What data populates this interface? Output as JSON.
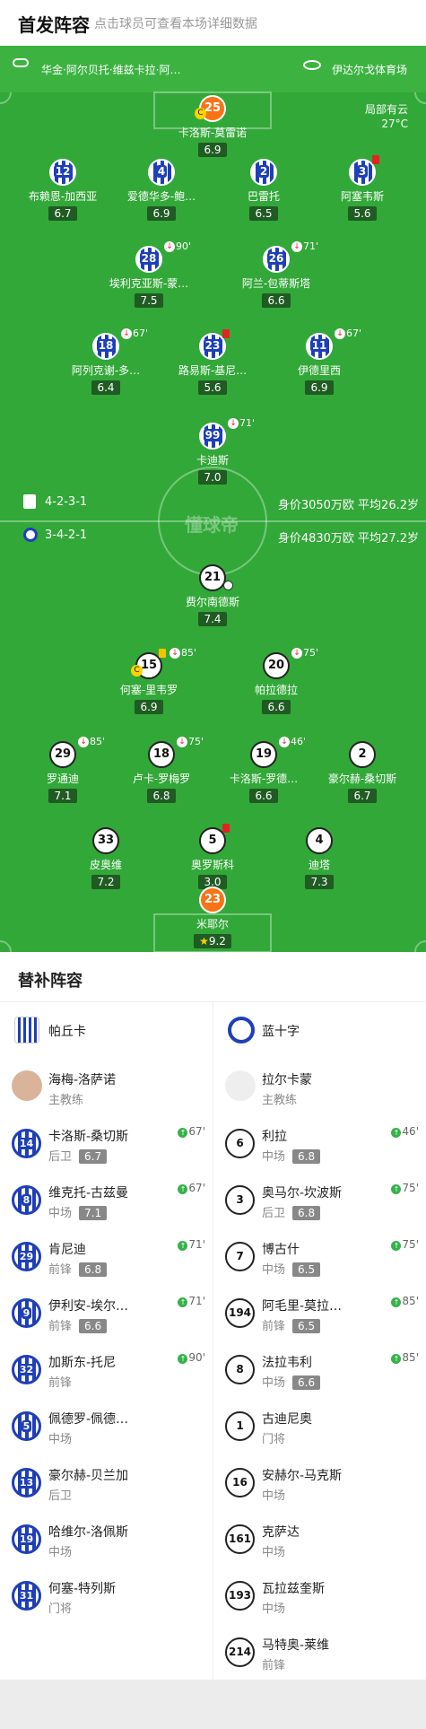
{
  "header": {
    "title": "首发阵容",
    "hint": "点击球员可查看本场详细数据"
  },
  "pitch": {
    "home_stadium": "华金·阿尔贝托·维兹卡拉·阿…",
    "away_stadium": "伊达尔戈体育场",
    "weather": "局部有云",
    "temperature": "27°C",
    "home_formation": "4-2-3-1",
    "home_value": "身价3050万欧 平均26.2岁",
    "away_formation": "3-4-2-1",
    "away_value": "身价4830万欧 平均27.2岁",
    "watermark": "懂球帝"
  },
  "home_players": [
    {
      "num": "25",
      "name": "卡洛斯-莫雷诺",
      "rating": "6.9"
    },
    {
      "num": "12",
      "name": "布赖恩-加西亚",
      "rating": "6.7"
    },
    {
      "num": "4",
      "name": "爱德华多-鲍…",
      "rating": "6.9"
    },
    {
      "num": "2",
      "name": "巴雷托",
      "rating": "6.5"
    },
    {
      "num": "3",
      "name": "阿塞韦斯",
      "rating": "5.6"
    },
    {
      "num": "28",
      "name": "埃利克亚斯-蒙…",
      "rating": "7.5",
      "sub": "90'"
    },
    {
      "num": "26",
      "name": "阿兰-包蒂斯塔",
      "rating": "6.6",
      "sub": "71'"
    },
    {
      "num": "18",
      "name": "阿列克谢-多…",
      "rating": "6.4",
      "sub": "67'"
    },
    {
      "num": "23",
      "name": "路易斯-基尼…",
      "rating": "5.6"
    },
    {
      "num": "11",
      "name": "伊德里西",
      "rating": "6.9",
      "sub": "67'"
    },
    {
      "num": "99",
      "name": "卡迪斯",
      "rating": "7.0",
      "sub": "71'"
    }
  ],
  "away_players": [
    {
      "num": "21",
      "name": "费尔南德斯",
      "rating": "7.4"
    },
    {
      "num": "15",
      "name": "何塞-里韦罗",
      "rating": "6.9",
      "sub": "85'"
    },
    {
      "num": "20",
      "name": "帕拉德拉",
      "rating": "6.6",
      "sub": "75'"
    },
    {
      "num": "29",
      "name": "罗通迪",
      "rating": "7.1",
      "sub": "85'"
    },
    {
      "num": "18",
      "name": "卢卡-罗梅罗",
      "rating": "6.8",
      "sub": "75'"
    },
    {
      "num": "19",
      "name": "卡洛斯-罗德…",
      "rating": "6.6",
      "sub": "46'"
    },
    {
      "num": "2",
      "name": "豪尔赫-桑切斯",
      "rating": "6.7"
    },
    {
      "num": "33",
      "name": "皮奥维",
      "rating": "7.2"
    },
    {
      "num": "5",
      "name": "奥罗斯科",
      "rating": "3.0"
    },
    {
      "num": "4",
      "name": "迪塔",
      "rating": "7.3"
    },
    {
      "num": "23",
      "name": "米耶尔",
      "rating": "9.2"
    }
  ],
  "subs": {
    "title": "替补阵容",
    "home_team": "帕丘卡",
    "away_team": "蓝十字",
    "home_coach": {
      "name": "海梅-洛萨诺",
      "role": "主教练"
    },
    "away_coach": {
      "name": "拉尔卡蒙",
      "role": "主教练"
    },
    "home": [
      {
        "num": "14",
        "name": "卡洛斯-桑切斯",
        "pos": "后卫",
        "rating": "6.7",
        "in": "67'"
      },
      {
        "num": "8",
        "name": "维克托-古兹曼",
        "pos": "中场",
        "rating": "7.1",
        "in": "67'"
      },
      {
        "num": "29",
        "name": "肯尼迪",
        "pos": "前锋",
        "rating": "6.8",
        "in": "71'"
      },
      {
        "num": "9",
        "name": "伊利安-埃尔…",
        "pos": "前锋",
        "rating": "6.6",
        "in": "71'"
      },
      {
        "num": "32",
        "name": "加斯东-托尼",
        "pos": "前锋",
        "rating": "",
        "in": "90'"
      },
      {
        "num": "5",
        "name": "佩德罗-佩德…",
        "pos": "中场",
        "rating": "",
        "in": ""
      },
      {
        "num": "13",
        "name": "豪尔赫-贝兰加",
        "pos": "后卫",
        "rating": "",
        "in": ""
      },
      {
        "num": "19",
        "name": "哈维尔-洛佩斯",
        "pos": "中场",
        "rating": "",
        "in": ""
      },
      {
        "num": "31",
        "name": "何塞-特列斯",
        "pos": "门将",
        "rating": "",
        "in": ""
      }
    ],
    "away": [
      {
        "num": "6",
        "name": "利拉",
        "pos": "中场",
        "rating": "6.8",
        "in": "46'"
      },
      {
        "num": "3",
        "name": "奥马尔-坎波斯",
        "pos": "后卫",
        "rating": "6.8",
        "in": "75'"
      },
      {
        "num": "7",
        "name": "博古什",
        "pos": "中场",
        "rating": "6.5",
        "in": "75'"
      },
      {
        "num": "194",
        "name": "阿毛里-莫拉…",
        "pos": "前锋",
        "rating": "6.5",
        "in": "85'"
      },
      {
        "num": "8",
        "name": "法拉韦利",
        "pos": "中场",
        "rating": "6.6",
        "in": "85'"
      },
      {
        "num": "1",
        "name": "古迪尼奥",
        "pos": "门将",
        "rating": "",
        "in": ""
      },
      {
        "num": "16",
        "name": "安赫尔-马克斯",
        "pos": "中场",
        "rating": "",
        "in": ""
      },
      {
        "num": "161",
        "name": "克萨达",
        "pos": "中场",
        "rating": "",
        "in": ""
      },
      {
        "num": "193",
        "name": "瓦拉兹奎斯",
        "pos": "中场",
        "rating": "",
        "in": ""
      },
      {
        "num": "214",
        "name": "马特奥-莱维",
        "pos": "前锋",
        "rating": "",
        "in": ""
      }
    ]
  }
}
